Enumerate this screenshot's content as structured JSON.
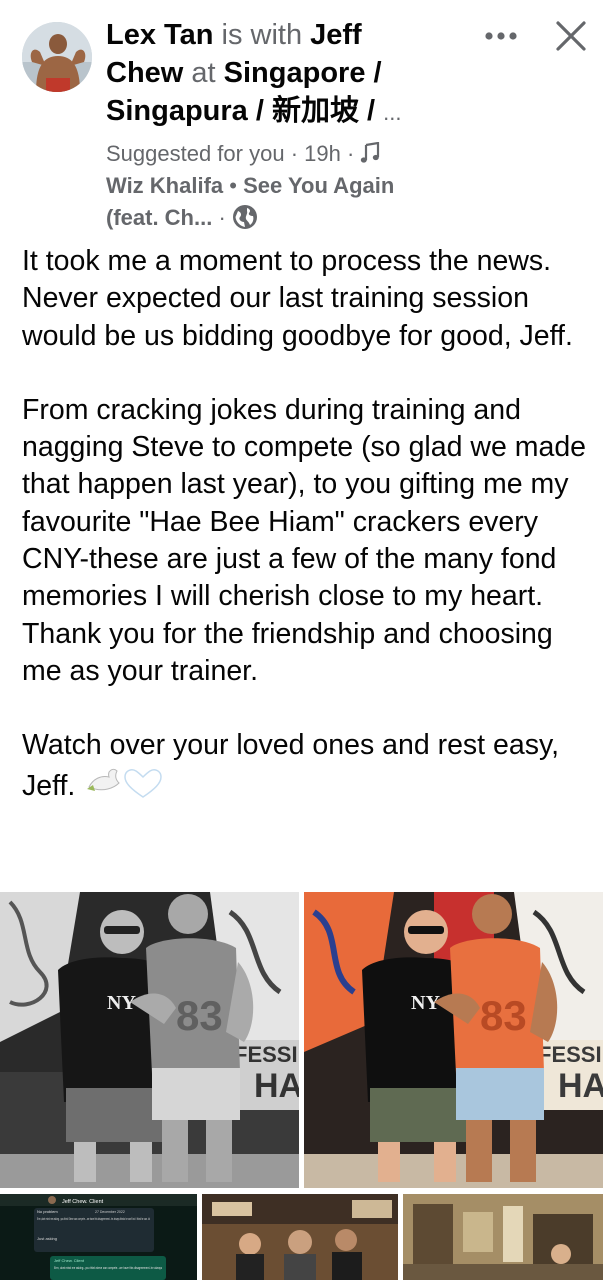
{
  "post": {
    "author": "Lex Tan",
    "with_text": "is with",
    "tagged": "Jeff",
    "tagged2": "Chew",
    "at_text": "at",
    "location1": "Singapore /",
    "location2": "Singapura / 新加坡 /",
    "ellipsis": "...",
    "suggested": "Suggested for you",
    "time": "19h",
    "music_artist": "Wiz Khalifa",
    "music_title": "See You Again",
    "music_title2": "(feat. Ch...",
    "sep": "·",
    "paragraph1": "It took me a moment to process the news. Never expected our last training session would be us bidding goodbye for good, Jeff.",
    "paragraph2": "From cracking jokes during training and nagging Steve to compete (so glad we made that happen last year), to you gifting me my favourite \"Hae Bee Hiam\" crackers every CNY-these are just a few of the many fond memories I will cherish close to my heart. Thank you for the friendship and choosing me as your trainer.",
    "paragraph3": "Watch over your loved ones and rest easy, Jeff.",
    "emojis": "🕊️🤍"
  },
  "photos": {
    "shirt_text": "NY",
    "banner_text1": "FESSI",
    "banner_text2": "HA",
    "jersey_text": "83",
    "chat_name": "Jeff Chew. Client",
    "chat_date": "27 December 2022",
    "chat_msg1": "No problem",
    "chat_msg2": "Erm ,dont mind me asking ..you think Steve can compete....we have this disagreement...he always thinks he can't but I think he can. lol",
    "chat_msg3": "Just asking",
    "chat_msg4": "Erm, dont mind me asking...you think steve can compete...we have this disagreement..he always"
  },
  "icons": {
    "more": "more-options-icon",
    "close": "close-icon",
    "music": "music-note-icon",
    "globe": "globe-icon"
  },
  "colors": {
    "text_primary": "#050505",
    "text_secondary": "#65676b"
  }
}
